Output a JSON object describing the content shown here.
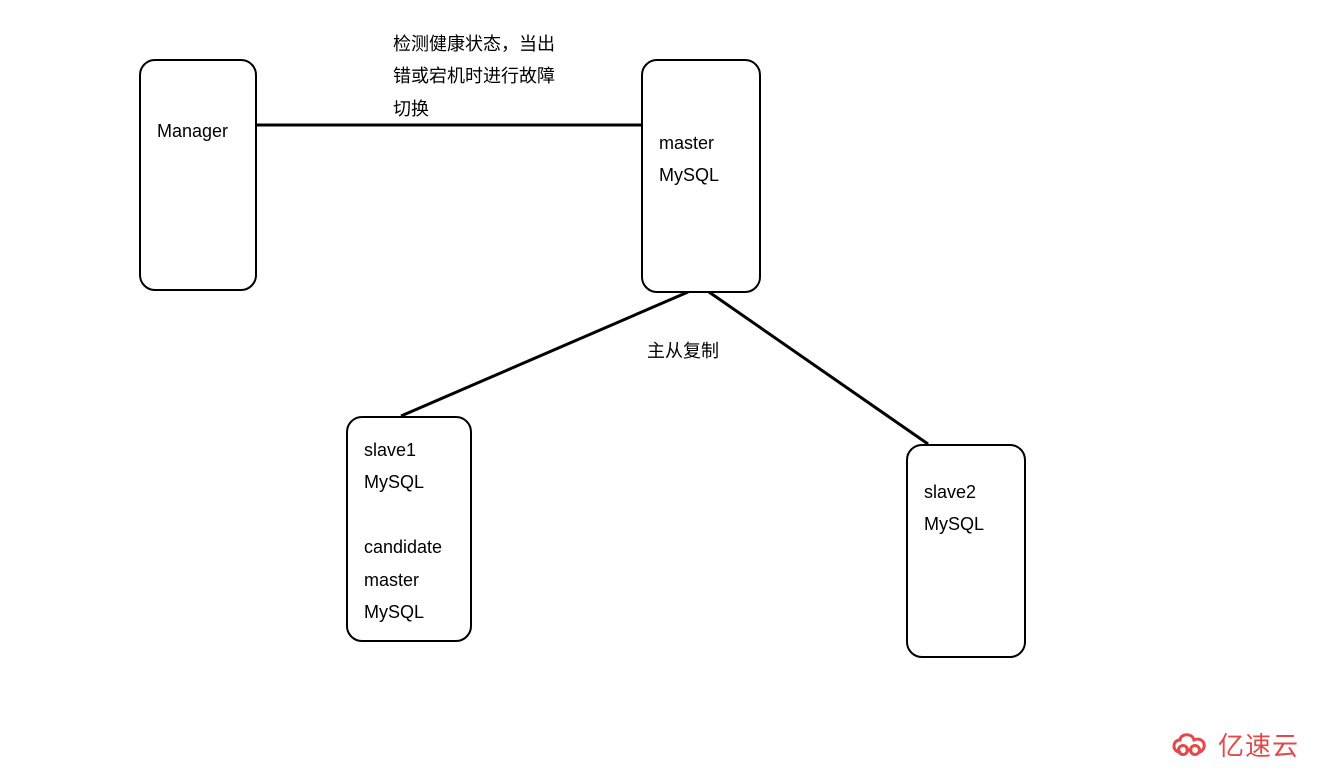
{
  "nodes": {
    "manager": {
      "lines": [
        "Manager"
      ]
    },
    "master": {
      "lines": [
        "master",
        "MySQL"
      ]
    },
    "slave1": {
      "lines": [
        "slave1",
        "MySQL",
        "",
        "candidate master",
        "MySQL"
      ]
    },
    "slave2": {
      "lines": [
        "slave2",
        "MySQL"
      ]
    }
  },
  "labels": {
    "healthcheck": {
      "lines": [
        "检测健康状态，当出",
        "错或宕机时进行故障",
        "切换"
      ]
    },
    "replication": "主从复制"
  },
  "watermark": "亿速云"
}
